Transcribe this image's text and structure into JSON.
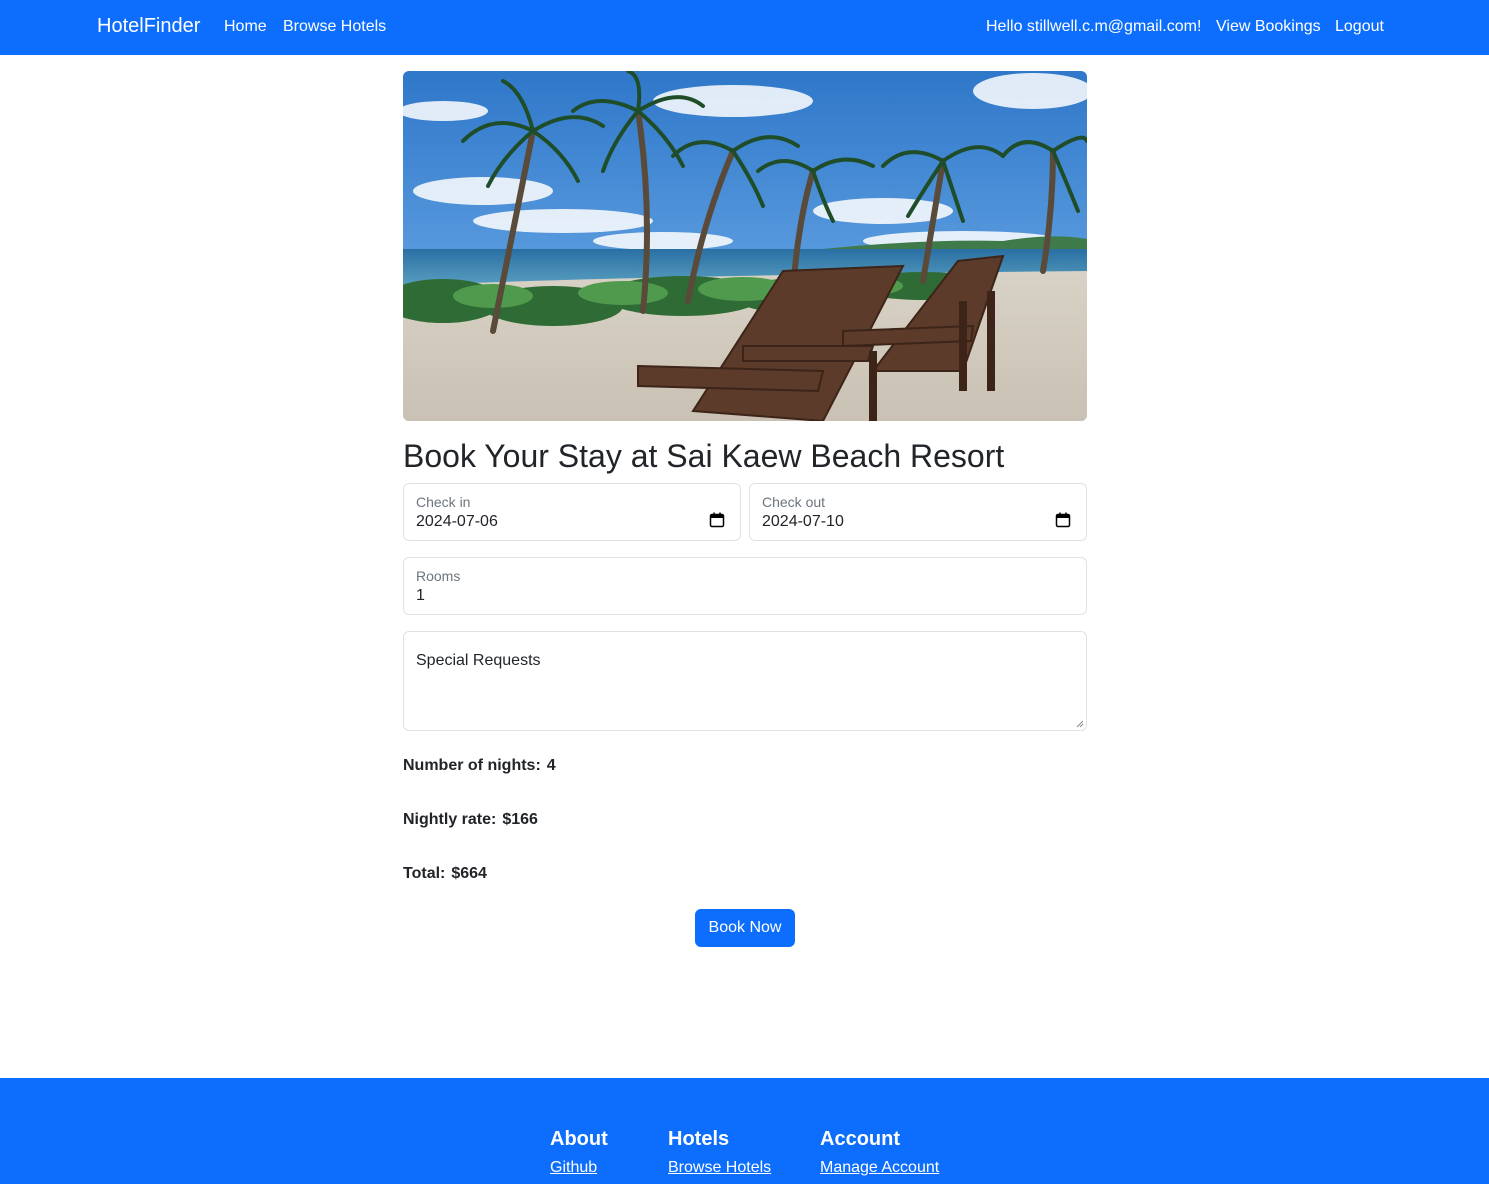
{
  "navbar": {
    "brand": "HotelFinder",
    "home": "Home",
    "browse_hotels": "Browse Hotels",
    "greeting": "Hello stillwell.c.m@gmail.com!",
    "view_bookings": "View Bookings",
    "logout": "Logout"
  },
  "hero": {
    "alt": "Beach with palm trees and wooden lounge chairs"
  },
  "page_title": "Book Your Stay at Sai Kaew Beach Resort",
  "form": {
    "check_in": {
      "label": "Check in",
      "value": "2024-07-06"
    },
    "check_out": {
      "label": "Check out",
      "value": "2024-07-10"
    },
    "rooms": {
      "label": "Rooms",
      "value": "1"
    },
    "special_requests": {
      "label": "Special Requests",
      "value": ""
    }
  },
  "summary": {
    "nights_label": "Number of nights:",
    "nights_value": "4",
    "rate_label": "Nightly rate:",
    "rate_value": "$166",
    "total_label": "Total:",
    "total_value": "$664"
  },
  "book_button": "Book Now",
  "footer": {
    "about": {
      "heading": "About",
      "link": "Github"
    },
    "hotels": {
      "heading": "Hotels",
      "link": "Browse Hotels"
    },
    "account": {
      "heading": "Account",
      "link": "Manage Account"
    }
  },
  "colors": {
    "primary": "#0d6efd",
    "text": "#212529",
    "border": "#dee2e6"
  },
  "icons": [
    "calendar-icon"
  ]
}
